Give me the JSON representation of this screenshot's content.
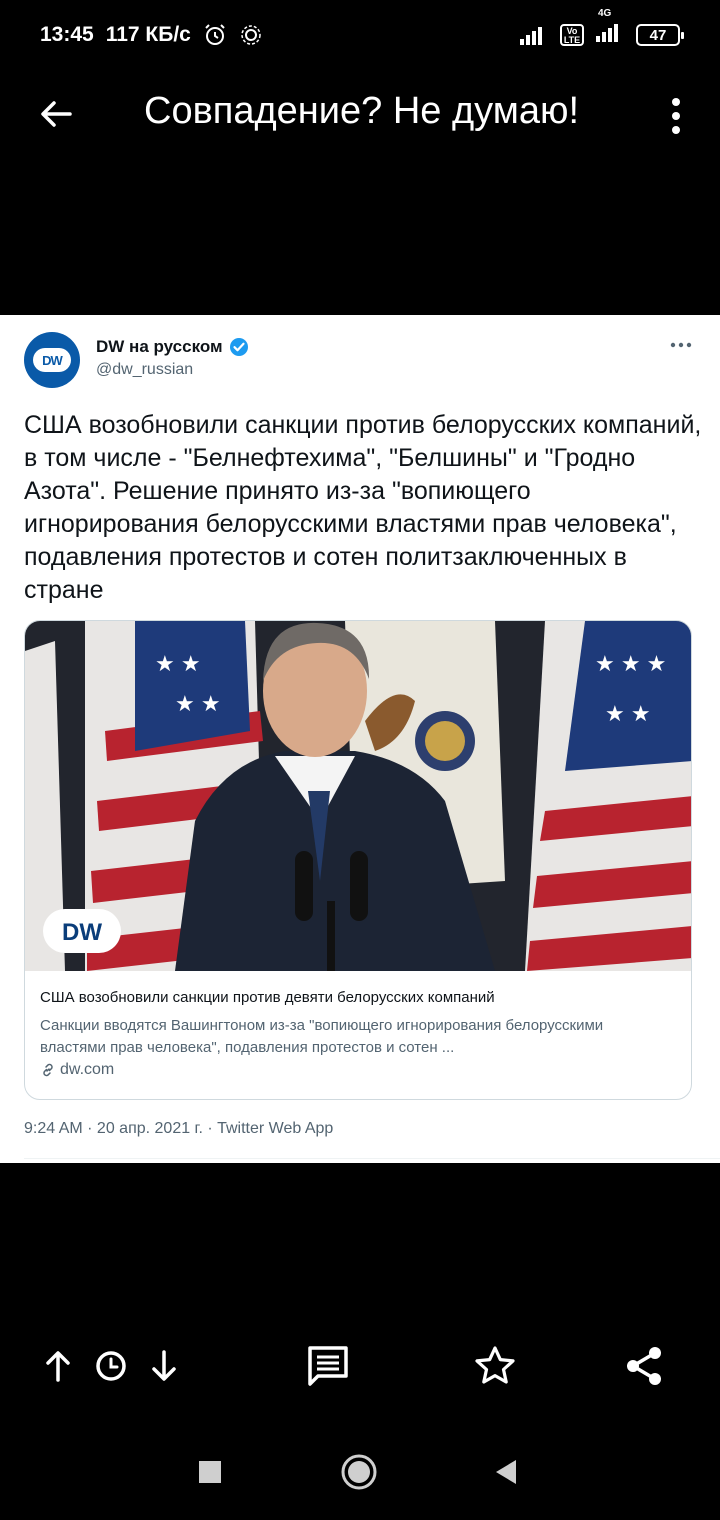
{
  "status_bar": {
    "time": "13:45",
    "speed": "117 КБ/с",
    "network": "4G",
    "volte": "Vo LTE",
    "battery": "47"
  },
  "app_bar": {
    "title": "Совпадение? Не думаю!"
  },
  "tweet": {
    "author_name": "DW на русском",
    "author_handle": "@dw_russian",
    "avatar_text": "DW",
    "text": "США возобновили санкции против белорусских компаний, в том числе - \"Белнефтехима\", \"Белшины\" и \"Гродно Азота\". Решение принято из-за \"вопиющего игнорирования белорусскими властями прав человека\", подавления протестов и сотен политзаключенных в стране",
    "card": {
      "image_watermark": "DW",
      "title": "США возобновили санкции против девяти белорусских компаний",
      "description": "Санкции вводятся Вашингтоном из-за \"вопиющего игнорирования белорусскими властями прав человека\", подавления протестов и сотен ...",
      "domain": "dw.com"
    },
    "timestamp": "9:24 AM · 20 апр. 2021 г. · Twitter Web App"
  },
  "toolbar": {
    "icons": [
      "arrow-up-icon",
      "clock-icon",
      "arrow-down-icon",
      "comment-icon",
      "star-icon",
      "share-icon"
    ]
  },
  "navigation": {
    "icons": [
      "recents-icon",
      "home-icon",
      "back-icon"
    ]
  },
  "colors": {
    "background": "#000000",
    "tweet_background": "#ffffff",
    "verified": "#1d9bf0",
    "dw_blue": "#0a5aa8",
    "secondary_text": "#536471"
  }
}
